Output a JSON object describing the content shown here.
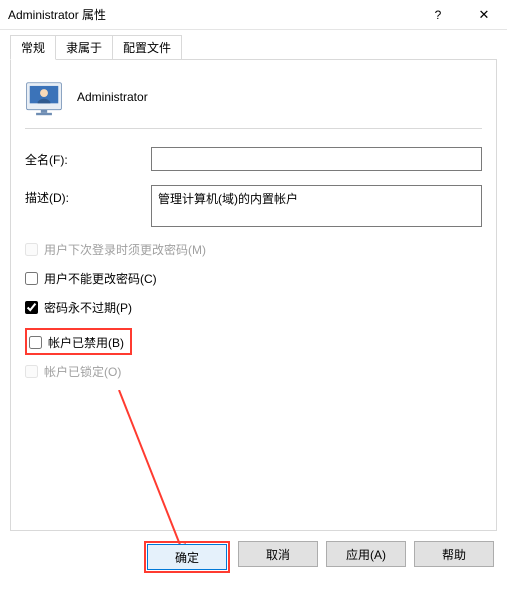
{
  "title": "Administrator 属性",
  "sys": {
    "help": "?",
    "close": "✕"
  },
  "tabs": [
    "常规",
    "隶属于",
    "配置文件"
  ],
  "active_tab": 0,
  "username_display": "Administrator",
  "fields": {
    "fullname": {
      "label": "全名(F):",
      "value": ""
    },
    "desc": {
      "label": "描述(D):",
      "value": "管理计算机(域)的内置帐户"
    }
  },
  "checks": {
    "must_change": {
      "label": "用户下次登录时须更改密码(M)",
      "checked": false,
      "enabled": false
    },
    "cannot_change": {
      "label": "用户不能更改密码(C)",
      "checked": false,
      "enabled": true
    },
    "never_expires": {
      "label": "密码永不过期(P)",
      "checked": true,
      "enabled": true
    },
    "disabled": {
      "label": "帐户已禁用(B)",
      "checked": false,
      "enabled": true
    },
    "locked": {
      "label": "帐户已锁定(O)",
      "checked": false,
      "enabled": false
    }
  },
  "buttons": {
    "ok": "确定",
    "cancel": "取消",
    "apply": "应用(A)",
    "help": "帮助"
  }
}
